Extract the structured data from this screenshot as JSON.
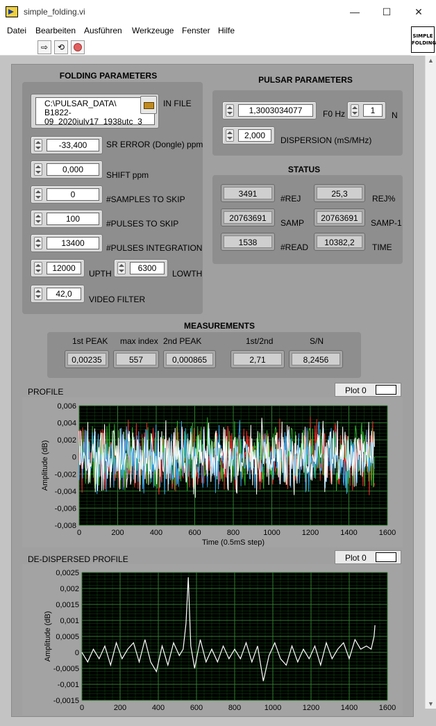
{
  "window": {
    "title": "simple_folding.vi",
    "minimize": "—",
    "maximize": "☐",
    "close": "✕"
  },
  "menu": [
    "Datei",
    "Bearbeiten",
    "Ausführen",
    "Werkzeuge",
    "Fenster",
    "Hilfe"
  ],
  "vi_icon": {
    "line1": "SIMPLE",
    "line2": "FOLDING"
  },
  "toolbar": {
    "run": "run-arrow-icon",
    "run_continuous": "run-continuous-icon",
    "abort": "abort-icon"
  },
  "folding": {
    "title": "FOLDING PARAMETERS",
    "in_file": {
      "label": "IN FILE",
      "value_lines": [
        "C:\\PULSAR_DATA\\",
        "B1822-",
        "09_2020july17_1938utc_3"
      ]
    },
    "sr_error": {
      "label": "SR ERROR (Dongle) ppm",
      "value": "-33,400"
    },
    "shift": {
      "label": "SHIFT ppm",
      "value": "0,000"
    },
    "samples_skip": {
      "label": "#SAMPLES TO SKIP",
      "value": "0"
    },
    "pulses_skip": {
      "label": "#PULSES TO SKIP",
      "value": "100"
    },
    "pulses_integration": {
      "label": "#PULSES INTEGRATION",
      "value": "13400"
    },
    "upth": {
      "label": "UPTH",
      "value": "12000"
    },
    "lowth": {
      "label": "LOWTH",
      "value": "6300"
    },
    "video_filter": {
      "label": "VIDEO FILTER",
      "value": "42,0"
    }
  },
  "pulsar": {
    "title": "PULSAR PARAMETERS",
    "f0": {
      "label": "F0 Hz",
      "value": "1,3003034077"
    },
    "n": {
      "label": "N",
      "value": "1"
    },
    "dispersion": {
      "label": "DISPERSION (mS/MHz)",
      "value": "2,000"
    }
  },
  "status": {
    "title": "STATUS",
    "rej": {
      "label": "#REJ",
      "value": "3491"
    },
    "rej_pct": {
      "label": "REJ%",
      "value": "25,3"
    },
    "samp": {
      "label": "SAMP",
      "value": "20763691"
    },
    "samp1": {
      "label": "SAMP-1",
      "value": "20763691"
    },
    "read": {
      "label": "#READ",
      "value": "1538"
    },
    "time": {
      "label": "TIME",
      "value": "10382,2"
    }
  },
  "measurements": {
    "title": "MEASUREMENTS",
    "first_peak": {
      "label": "1st PEAK",
      "value": "0,00235"
    },
    "max_index": {
      "label": "max index",
      "value": "557"
    },
    "second_peak": {
      "label": "2nd PEAK",
      "value": "0,000865"
    },
    "ratio": {
      "label": "1st/2nd",
      "value": "2,71"
    },
    "sn": {
      "label": "S/N",
      "value": "8,2456"
    }
  },
  "profile_plot": {
    "label": "PROFILE",
    "legend": "Plot 0"
  },
  "dedisp_plot": {
    "label": "DE-DISPERSED PROFILE",
    "legend": "Plot 0"
  },
  "colors": {
    "plot_bg": "#000000",
    "grid": "#2e7d2e",
    "panel": "#a0a0a0",
    "group": "#8e8e8e"
  },
  "chart_data": [
    {
      "type": "line",
      "title": "",
      "xlabel": "Time (0.5mS step)",
      "ylabel": "Amplitude (dB)",
      "xlim": [
        0,
        1600
      ],
      "ylim": [
        -0.008,
        0.006
      ],
      "x_ticks": [
        "0",
        "200",
        "400",
        "600",
        "800",
        "1000",
        "1200",
        "1400",
        "1600"
      ],
      "y_ticks": [
        "0,006",
        "0,004",
        "0,002",
        "0",
        "-0,002",
        "-0,004",
        "-0,006",
        "-0,008"
      ],
      "x_range_data": [
        0,
        1535
      ],
      "noise_amplitude": 0.005,
      "series_colors": [
        "#ff3030",
        "#30c030",
        "#40b0ff",
        "#ffffff"
      ],
      "grid": true
    },
    {
      "type": "line",
      "title": "",
      "xlabel": "",
      "ylabel": "Amplitude (dB)",
      "xlim": [
        0,
        1600
      ],
      "ylim": [
        -0.0015,
        0.0025
      ],
      "x_ticks": [
        "0",
        "200",
        "400",
        "600",
        "800",
        "1000",
        "1200",
        "1400",
        "1600"
      ],
      "y_ticks": [
        "0,0025",
        "0,002",
        "0,0015",
        "0,001",
        "0,0005",
        "0",
        "-0,0005",
        "-0,001",
        "-0,0015"
      ],
      "series": [
        {
          "color": "#ffffff",
          "x": [
            0,
            30,
            60,
            90,
            120,
            150,
            180,
            210,
            240,
            270,
            300,
            330,
            360,
            390,
            420,
            450,
            480,
            510,
            530,
            545,
            557,
            570,
            590,
            620,
            650,
            680,
            710,
            740,
            770,
            800,
            830,
            860,
            890,
            920,
            950,
            980,
            1010,
            1040,
            1070,
            1100,
            1130,
            1160,
            1190,
            1220,
            1250,
            1280,
            1310,
            1340,
            1370,
            1400,
            1430,
            1460,
            1490,
            1515,
            1530,
            1535
          ],
          "y": [
            0.0,
            -0.0003,
            0.0001,
            -0.0002,
            0.0002,
            -0.0004,
            0.0003,
            -0.0002,
            0.0001,
            0.0003,
            -0.0003,
            0.0004,
            -0.0003,
            -0.0006,
            0.0002,
            -0.0004,
            0.0003,
            -0.0001,
            0.0001,
            0.0009,
            0.00235,
            0.0002,
            -0.0005,
            0.0004,
            -0.0003,
            0.0001,
            -0.0003,
            0.0002,
            -0.0002,
            0.0001,
            -0.0002,
            0.0003,
            -0.0003,
            0.0002,
            -0.0009,
            -0.0001,
            0.0003,
            -0.0002,
            -0.0004,
            0.0002,
            -0.0003,
            0.0001,
            -0.0002,
            0.0002,
            -0.0004,
            0.0003,
            -0.0002,
            0.0001,
            0.0003,
            -0.0002,
            0.0004,
            0.0001,
            0.0002,
            0.0001,
            0.0005,
            0.00085
          ]
        }
      ],
      "grid": true
    }
  ]
}
